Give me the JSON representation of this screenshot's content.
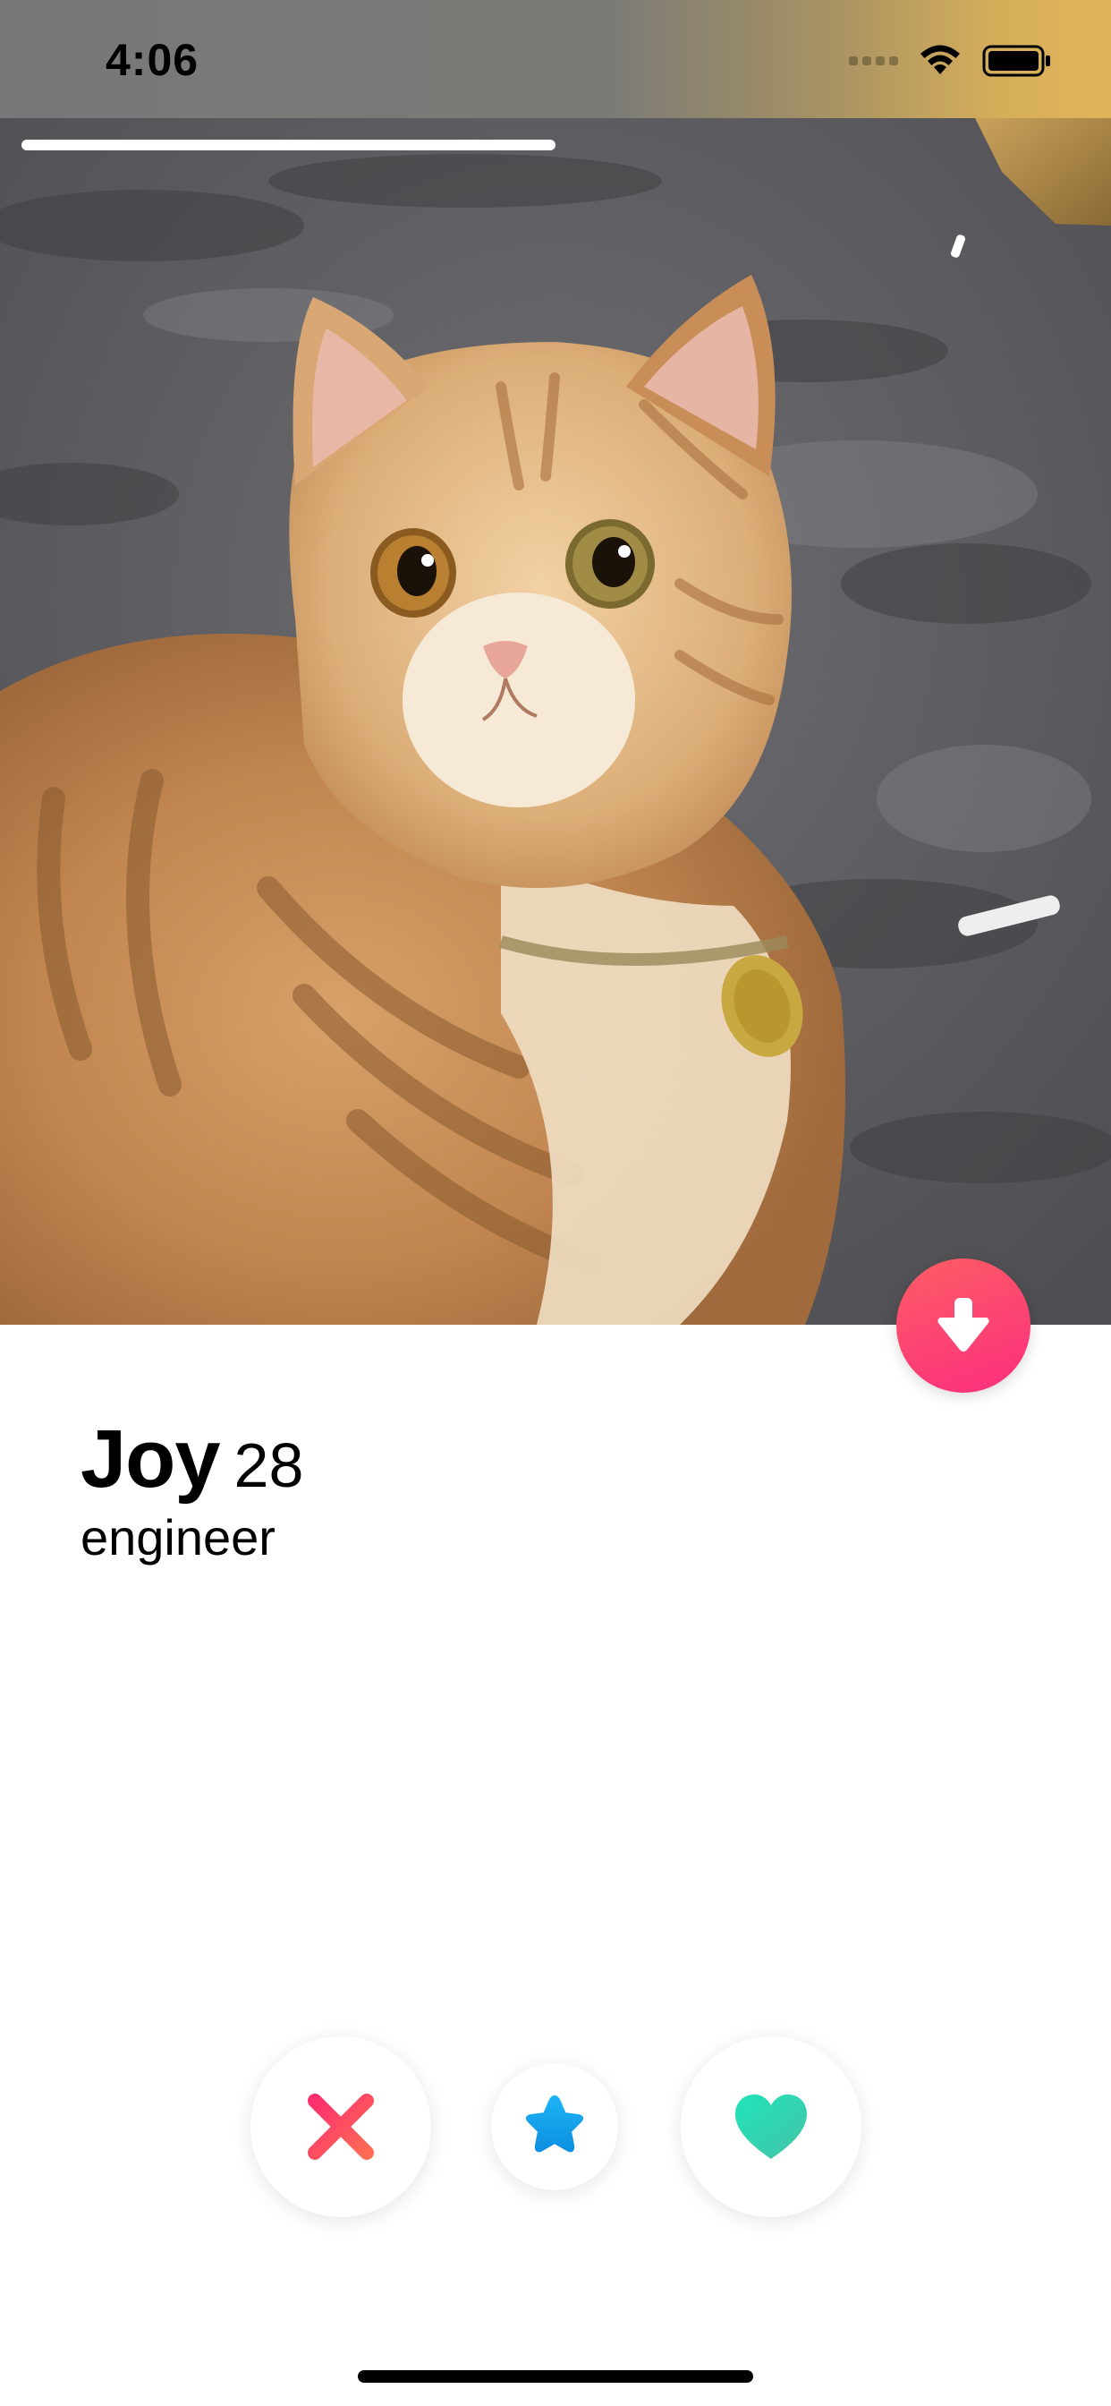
{
  "status_bar": {
    "time": "4:06",
    "icons": [
      "cellular-signal-icon",
      "wifi-icon",
      "battery-icon"
    ]
  },
  "photo": {
    "subject": "cat-photo",
    "progress_fraction": 0.5
  },
  "profile": {
    "name": "Joy",
    "age": "28",
    "job": "engineer"
  },
  "actions": {
    "nope_icon": "close-icon",
    "super_like_icon": "star-icon",
    "like_icon": "heart-icon",
    "info_icon": "arrow-down-icon"
  },
  "colors": {
    "nope": "#fd5068",
    "super_like": "#1aa7f0",
    "like_start": "#25e0b0",
    "like_end": "#40c9a6",
    "info_button": "#fc3a72"
  }
}
